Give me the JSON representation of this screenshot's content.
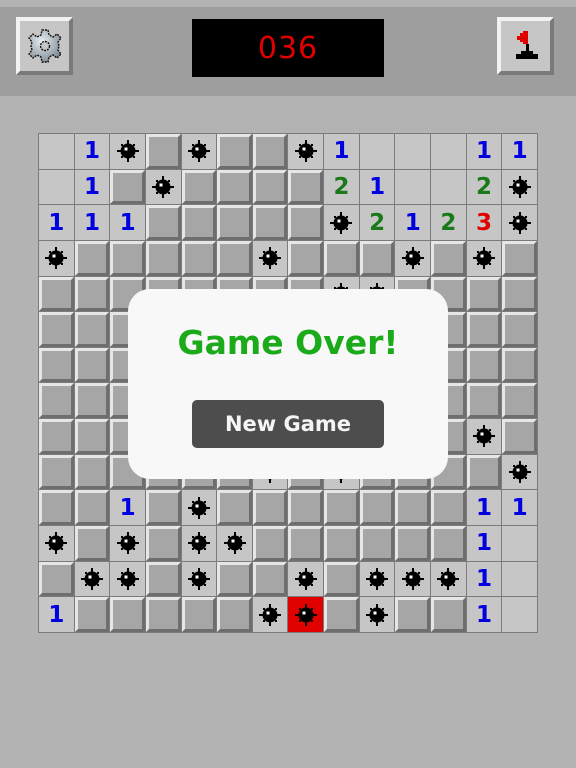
{
  "header": {
    "settings_icon": "gear-icon",
    "mine_counter": "036",
    "mode_icon": "flag-icon"
  },
  "board": {
    "cols": 14,
    "rows": 14,
    "legend": {
      "u": "unrevealed",
      "e": "revealed-empty",
      "m": "mine",
      "x": "exploded-mine",
      "1-8": "adjacent-mine-count"
    },
    "grid": [
      [
        "e",
        "1",
        "m",
        "u",
        "m",
        "u",
        "u",
        "m",
        "1",
        "e",
        "e",
        "e",
        "1",
        "1"
      ],
      [
        "e",
        "1",
        "u",
        "m",
        "u",
        "u",
        "u",
        "u",
        "2",
        "1",
        "e",
        "e",
        "2",
        "m"
      ],
      [
        "1",
        "1",
        "1",
        "u",
        "u",
        "u",
        "u",
        "u",
        "m",
        "2",
        "1",
        "2",
        "3",
        "m"
      ],
      [
        "m",
        "u",
        "u",
        "u",
        "u",
        "u",
        "m",
        "u",
        "u",
        "u",
        "m",
        "u",
        "m",
        "u"
      ],
      [
        "u",
        "u",
        "u",
        "u",
        "u",
        "u",
        "u",
        "u",
        "m",
        "m",
        "u",
        "u",
        "u",
        "u"
      ],
      [
        "u",
        "u",
        "u",
        "u",
        "u",
        "u",
        "u",
        "u",
        "u",
        "u",
        "u",
        "u",
        "u",
        "u"
      ],
      [
        "u",
        "u",
        "u",
        "u",
        "u",
        "u",
        "u",
        "u",
        "u",
        "u",
        "u",
        "u",
        "u",
        "u"
      ],
      [
        "u",
        "u",
        "u",
        "u",
        "u",
        "u",
        "u",
        "u",
        "u",
        "u",
        "u",
        "u",
        "u",
        "u"
      ],
      [
        "u",
        "u",
        "u",
        "u",
        "u",
        "u",
        "u",
        "u",
        "u",
        "u",
        "u",
        "u",
        "m",
        "u"
      ],
      [
        "u",
        "u",
        "u",
        "u",
        "u",
        "u",
        "m",
        "u",
        "m",
        "u",
        "u",
        "u",
        "u",
        "m"
      ],
      [
        "u",
        "u",
        "1",
        "u",
        "m",
        "u",
        "u",
        "u",
        "u",
        "u",
        "u",
        "u",
        "1",
        "1"
      ],
      [
        "m",
        "u",
        "m",
        "u",
        "m",
        "m",
        "u",
        "u",
        "u",
        "u",
        "u",
        "u",
        "1",
        "e"
      ],
      [
        "u",
        "m",
        "m",
        "u",
        "m",
        "u",
        "u",
        "m",
        "u",
        "m",
        "m",
        "m",
        "1",
        "e"
      ],
      [
        "1",
        "u",
        "u",
        "u",
        "u",
        "u",
        "m",
        "x",
        "u",
        "m",
        "u",
        "u",
        "1",
        "e"
      ]
    ],
    "number_colors": {
      "1": "#0000e0",
      "2": "#1a7a1a",
      "3": "#e00000"
    },
    "exploded_color": "#e00000"
  },
  "dialog": {
    "title": "Game Over!",
    "title_color": "#1aaa1a",
    "button_label": "New Game"
  }
}
